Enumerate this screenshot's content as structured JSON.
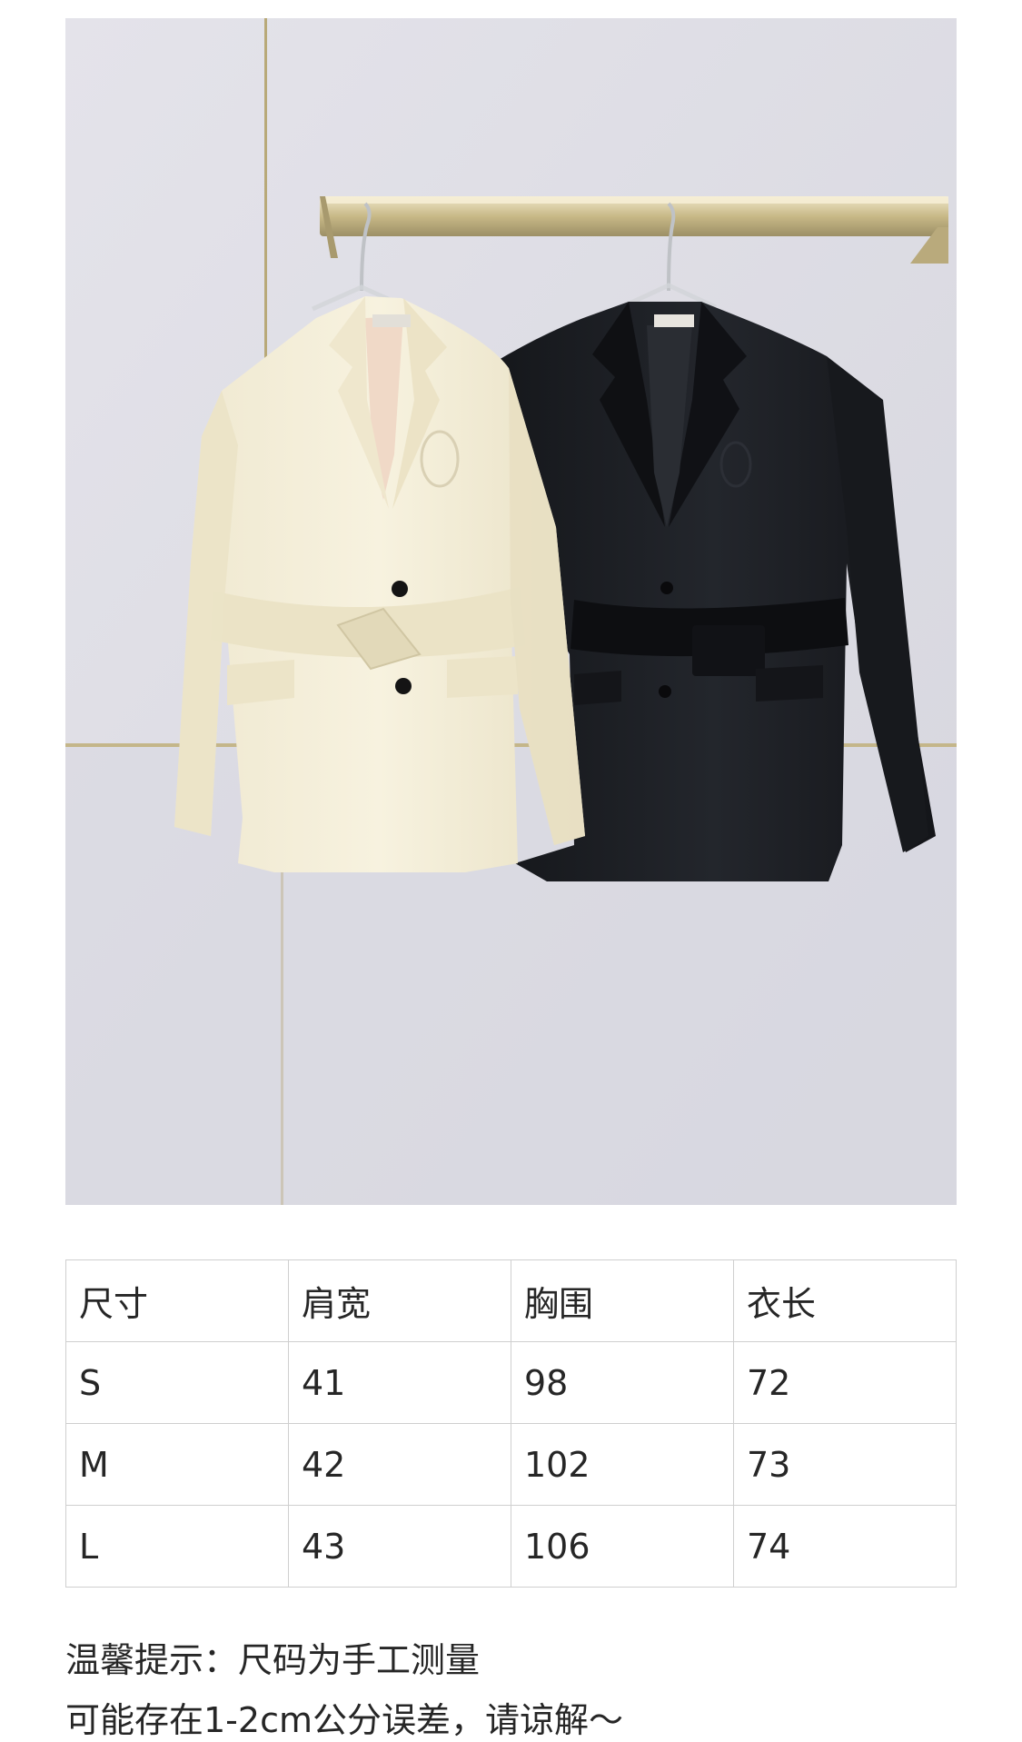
{
  "photo": {
    "label_alt": "belted blazer product photo, cream and black"
  },
  "size_table": {
    "headers": [
      "尺寸",
      "肩宽",
      "胸围",
      "衣长"
    ],
    "rows": [
      [
        "S",
        "41",
        "98",
        "72"
      ],
      [
        "M",
        "42",
        "102",
        "73"
      ],
      [
        "L",
        "43",
        "106",
        "74"
      ]
    ]
  },
  "notice": {
    "line1": "温馨提示：尺码为手工测量",
    "line2": "可能存在1-2cm公分误差，请谅解～"
  },
  "colors": {
    "wall": "#dcdce4",
    "cream": "#f4efdc",
    "black": "#1b1d22",
    "gold": "#c9b98a",
    "table_border": "#cfcfcf"
  }
}
